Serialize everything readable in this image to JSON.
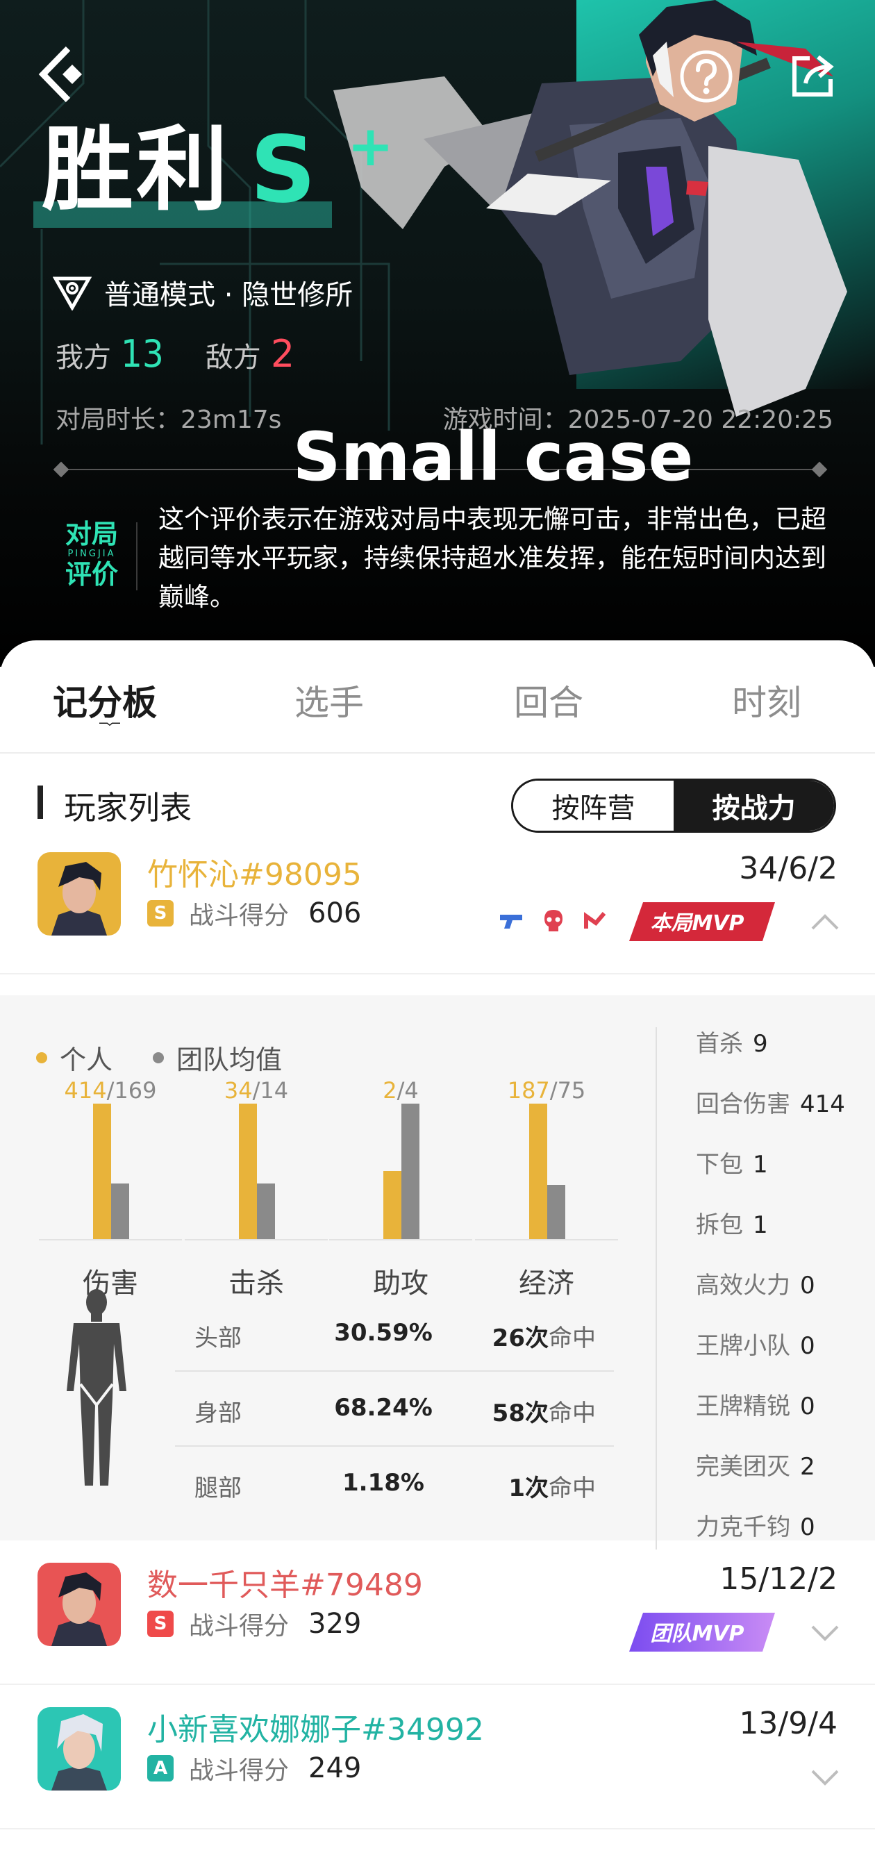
{
  "header": {
    "title": "胜利",
    "rank": "S",
    "rank_plus": "+",
    "mode": "普通模式 · 隐世修所",
    "our_label": "我方",
    "our_score": "13",
    "enemy_label": "敌方",
    "enemy_score": "2",
    "duration": "对局时长：23m17s",
    "game_time": "游戏时间：2025-07-20 22:20:25",
    "eval_title": "Small case",
    "eval_badge_top": "对局",
    "eval_badge_mid": "PINGJIA",
    "eval_badge_bottom": "评价",
    "eval_desc": "这个评价表示在游戏对局中表现无懈可击，非常出色，已超越同等水平玩家，持续保持超水准发挥，能在短时间内达到巅峰。"
  },
  "tabs": [
    "记分板",
    "选手",
    "回合",
    "时刻"
  ],
  "section": {
    "title": "玩家列表",
    "toggle_off": "按阵营",
    "toggle_on": "按战力"
  },
  "players": [
    {
      "name": "竹怀沁#98095",
      "rank": "S",
      "score_label": "战斗得分",
      "score": "606",
      "kda": "34/6/2",
      "mvp": "本局MVP",
      "name_color": "#e8b33a",
      "chip_color": "#e8b33a"
    },
    {
      "name": "数一千只羊#79489",
      "rank": "S",
      "score_label": "战斗得分",
      "score": "329",
      "kda": "15/12/2",
      "mvp": "团队MVP",
      "name_color": "#e05a5a",
      "chip_color": "#ef4a4a"
    },
    {
      "name": "小新喜欢娜娜子#34992",
      "rank": "A",
      "score_label": "战斗得分",
      "score": "249",
      "kda": "13/9/4",
      "name_color": "#22b3a3",
      "chip_color": "#22b3a3"
    }
  ],
  "detail": {
    "legend_mine": "个人",
    "legend_team": "团队均值",
    "mine_color": "#e8b33a",
    "team_color": "#8a8a8a",
    "chart_data": {
      "type": "bar",
      "categories": [
        "伤害",
        "击杀",
        "助攻",
        "经济"
      ],
      "series": [
        {
          "name": "个人",
          "values": [
            414,
            34,
            2,
            187
          ]
        },
        {
          "name": "团队均值",
          "values": [
            169,
            14,
            4,
            75
          ]
        }
      ],
      "value_labels_mine": [
        "414",
        "34",
        "2",
        "187"
      ],
      "value_labels_team": [
        "/169",
        "/14",
        "/4",
        "/75"
      ]
    },
    "hits": [
      {
        "part": "头部",
        "pct": "30.59%",
        "count": "26次",
        "suffix": "命中"
      },
      {
        "part": "身部",
        "pct": "68.24%",
        "count": "58次",
        "suffix": "命中"
      },
      {
        "part": "腿部",
        "pct": "1.18%",
        "count": "1次",
        "suffix": "命中"
      }
    ],
    "stats": [
      {
        "label": "首杀",
        "value": "9"
      },
      {
        "label": "回合伤害",
        "value": "414"
      },
      {
        "label": "下包",
        "value": "1"
      },
      {
        "label": "拆包",
        "value": "1"
      },
      {
        "label": "高效火力",
        "value": "0"
      },
      {
        "label": "王牌小队",
        "value": "0"
      },
      {
        "label": "王牌精锐",
        "value": "0"
      },
      {
        "label": "完美团灭",
        "value": "2"
      },
      {
        "label": "力克千钧",
        "value": "0"
      }
    ]
  }
}
